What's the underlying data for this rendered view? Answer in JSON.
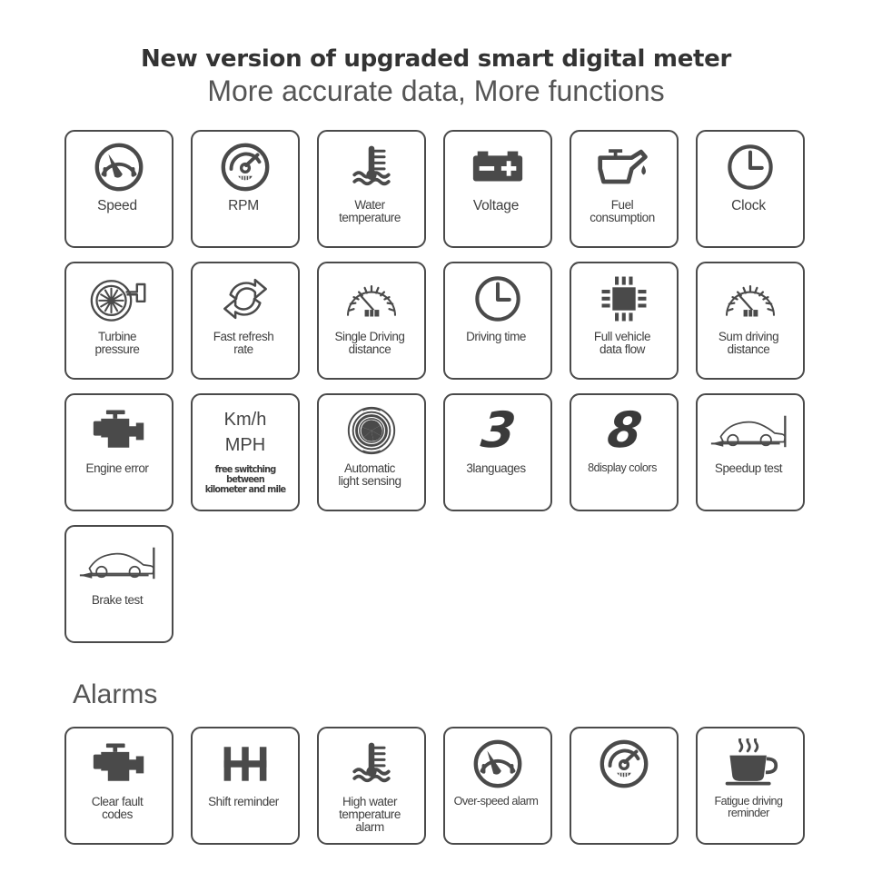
{
  "headings": {
    "title": "New version of upgraded smart digital meter",
    "subtitle": "More accurate data,  More functions"
  },
  "features": [
    {
      "label": "Speed",
      "icon": "speedometer-icon"
    },
    {
      "label": "RPM",
      "icon": "tachometer-icon"
    },
    {
      "label": "Water\ntemperature",
      "icon": "water-temperature-icon",
      "size": "sm"
    },
    {
      "label": "Voltage",
      "icon": "battery-icon"
    },
    {
      "label": "Fuel\nconsumption",
      "icon": "oil-can-icon",
      "size": "sm"
    },
    {
      "label": "Clock",
      "icon": "clock-icon"
    },
    {
      "label": "Turbine\npressure",
      "icon": "turbo-icon",
      "size": "sm"
    },
    {
      "label": "Fast refresh\nrate",
      "icon": "refresh-arrows-icon",
      "size": "sm"
    },
    {
      "label": "Single Driving\ndistance",
      "icon": "odometer-icon",
      "size": "sm"
    },
    {
      "label": "Driving time",
      "icon": "clock-icon",
      "size": "sm"
    },
    {
      "label": "Full vehicle\ndata flow",
      "icon": "chip-icon",
      "size": "sm"
    },
    {
      "label": "Sum driving\ndistance",
      "icon": "odometer-icon",
      "size": "sm"
    },
    {
      "label": "Engine error",
      "icon": "engine-icon",
      "size": "sm"
    },
    {
      "label": "",
      "icon": "unit-switch-text",
      "unit_primary": "Km/h",
      "unit_secondary": "MPH",
      "unit_note": "free switching between\nkilometer and mile"
    },
    {
      "label": "Automatic\nlight sensing",
      "icon": "light-sensor-icon",
      "size": "sm"
    },
    {
      "label": "3languages",
      "icon": "digit-3-icon",
      "size": "sm"
    },
    {
      "label": "8display colors",
      "icon": "digit-8-icon",
      "size": "xs"
    },
    {
      "label": "Speedup test",
      "icon": "car-accelerate-icon",
      "size": "sm"
    },
    {
      "label": "Brake test",
      "icon": "car-brake-icon",
      "size": "sm"
    }
  ],
  "alarms": {
    "heading": "Alarms",
    "items": [
      {
        "label": "Clear fault\ncodes",
        "icon": "engine-icon",
        "size": "sm"
      },
      {
        "label": "Shift reminder",
        "icon": "shift-gate-icon",
        "size": "sm"
      },
      {
        "label": "High water\ntemperature\nalarm",
        "icon": "water-temperature-icon",
        "size": "sm"
      },
      {
        "label": "Over-speed alarm",
        "icon": "speedometer-icon",
        "size": "xs"
      },
      {
        "label": "",
        "icon": "tachometer-icon"
      },
      {
        "label": "Fatigue driving\nreminder",
        "icon": "coffee-cup-icon",
        "size": "xs"
      }
    ]
  },
  "colors": {
    "stroke": "#4a4a4a",
    "fill": "#4a4a4a",
    "text": "#3f3f3f",
    "background": "#ffffff"
  }
}
